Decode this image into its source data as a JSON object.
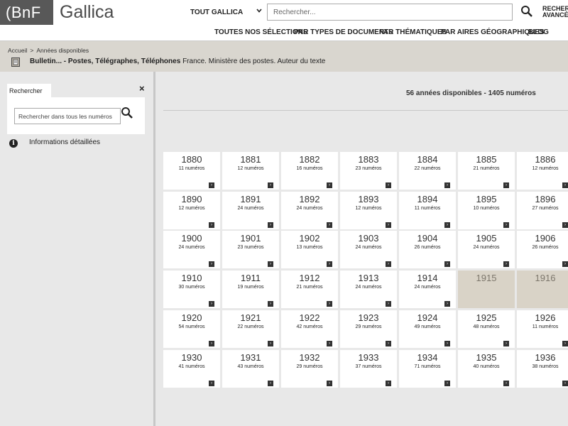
{
  "header": {
    "logo_bnf": "(BnF",
    "logo_gallica": "Gallica",
    "scope_label": "TOUT GALLICA",
    "search_placeholder": "Rechercher...",
    "advanced_search": "RECHERCHE AVANCÉE"
  },
  "nav": {
    "items": [
      "TOUTES NOS SÉLECTIONS",
      "PAR TYPES DE DOCUMENTS",
      "PAR THÉMATIQUES",
      "PAR AIRES GÉOGRAPHIQUES",
      "BLOG"
    ]
  },
  "breadcrumb": {
    "home": "Accueil",
    "separator": ">",
    "current": "Années disponibles"
  },
  "document": {
    "title_bold": "Bulletin... - Postes, Télégraphes, Téléphones",
    "author": "France. Ministère des postes. Auteur du texte"
  },
  "sidebar": {
    "tab_label": "Rechercher",
    "close": "×",
    "search_placeholder": "Rechercher dans tous les numéros",
    "info_label": "Informations détaillées"
  },
  "main": {
    "summary": "56 années disponibles - 1405 numéros",
    "years": [
      {
        "year": "1880",
        "count": "11 numéros",
        "available": true
      },
      {
        "year": "1881",
        "count": "12 numéros",
        "available": true
      },
      {
        "year": "1882",
        "count": "16 numéros",
        "available": true
      },
      {
        "year": "1883",
        "count": "23 numéros",
        "available": true
      },
      {
        "year": "1884",
        "count": "22 numéros",
        "available": true
      },
      {
        "year": "1885",
        "count": "21 numéros",
        "available": true
      },
      {
        "year": "1886",
        "count": "12 numéros",
        "available": true
      },
      {
        "year": "1890",
        "count": "12 numéros",
        "available": true
      },
      {
        "year": "1891",
        "count": "24 numéros",
        "available": true
      },
      {
        "year": "1892",
        "count": "24 numéros",
        "available": true
      },
      {
        "year": "1893",
        "count": "12 numéros",
        "available": true
      },
      {
        "year": "1894",
        "count": "11 numéros",
        "available": true
      },
      {
        "year": "1895",
        "count": "10 numéros",
        "available": true
      },
      {
        "year": "1896",
        "count": "27 numéros",
        "available": true
      },
      {
        "year": "1900",
        "count": "24 numéros",
        "available": true
      },
      {
        "year": "1901",
        "count": "23 numéros",
        "available": true
      },
      {
        "year": "1902",
        "count": "13 numéros",
        "available": true
      },
      {
        "year": "1903",
        "count": "24 numéros",
        "available": true
      },
      {
        "year": "1904",
        "count": "26 numéros",
        "available": true
      },
      {
        "year": "1905",
        "count": "24 numéros",
        "available": true
      },
      {
        "year": "1906",
        "count": "26 numéros",
        "available": true
      },
      {
        "year": "1910",
        "count": "30 numéros",
        "available": true
      },
      {
        "year": "1911",
        "count": "19 numéros",
        "available": true
      },
      {
        "year": "1912",
        "count": "21 numéros",
        "available": true
      },
      {
        "year": "1913",
        "count": "24 numéros",
        "available": true
      },
      {
        "year": "1914",
        "count": "24 numéros",
        "available": true
      },
      {
        "year": "1915",
        "count": "",
        "available": false
      },
      {
        "year": "1916",
        "count": "",
        "available": false
      },
      {
        "year": "1920",
        "count": "54 numéros",
        "available": true
      },
      {
        "year": "1921",
        "count": "22 numéros",
        "available": true
      },
      {
        "year": "1922",
        "count": "42 numéros",
        "available": true
      },
      {
        "year": "1923",
        "count": "29 numéros",
        "available": true
      },
      {
        "year": "1924",
        "count": "49 numéros",
        "available": true
      },
      {
        "year": "1925",
        "count": "48 numéros",
        "available": true
      },
      {
        "year": "1926",
        "count": "11 numéros",
        "available": true
      },
      {
        "year": "1930",
        "count": "41 numéros",
        "available": true
      },
      {
        "year": "1931",
        "count": "43 numéros",
        "available": true
      },
      {
        "year": "1932",
        "count": "29 numéros",
        "available": true
      },
      {
        "year": "1933",
        "count": "37 numéros",
        "available": true
      },
      {
        "year": "1934",
        "count": "71 numéros",
        "available": true
      },
      {
        "year": "1935",
        "count": "40 numéros",
        "available": true
      },
      {
        "year": "1936",
        "count": "38 numéros",
        "available": true
      }
    ]
  },
  "colors": {
    "logo_bg": "#585858",
    "context_bg": "#d9d6cf",
    "disabled_card_bg": "#d9d3c7"
  },
  "icons": {
    "search": "search-icon",
    "chevron": "chevron-down-icon",
    "info": "info-icon",
    "close": "close-icon",
    "arrow": "arrow-right-icon",
    "document": "document-icon"
  }
}
